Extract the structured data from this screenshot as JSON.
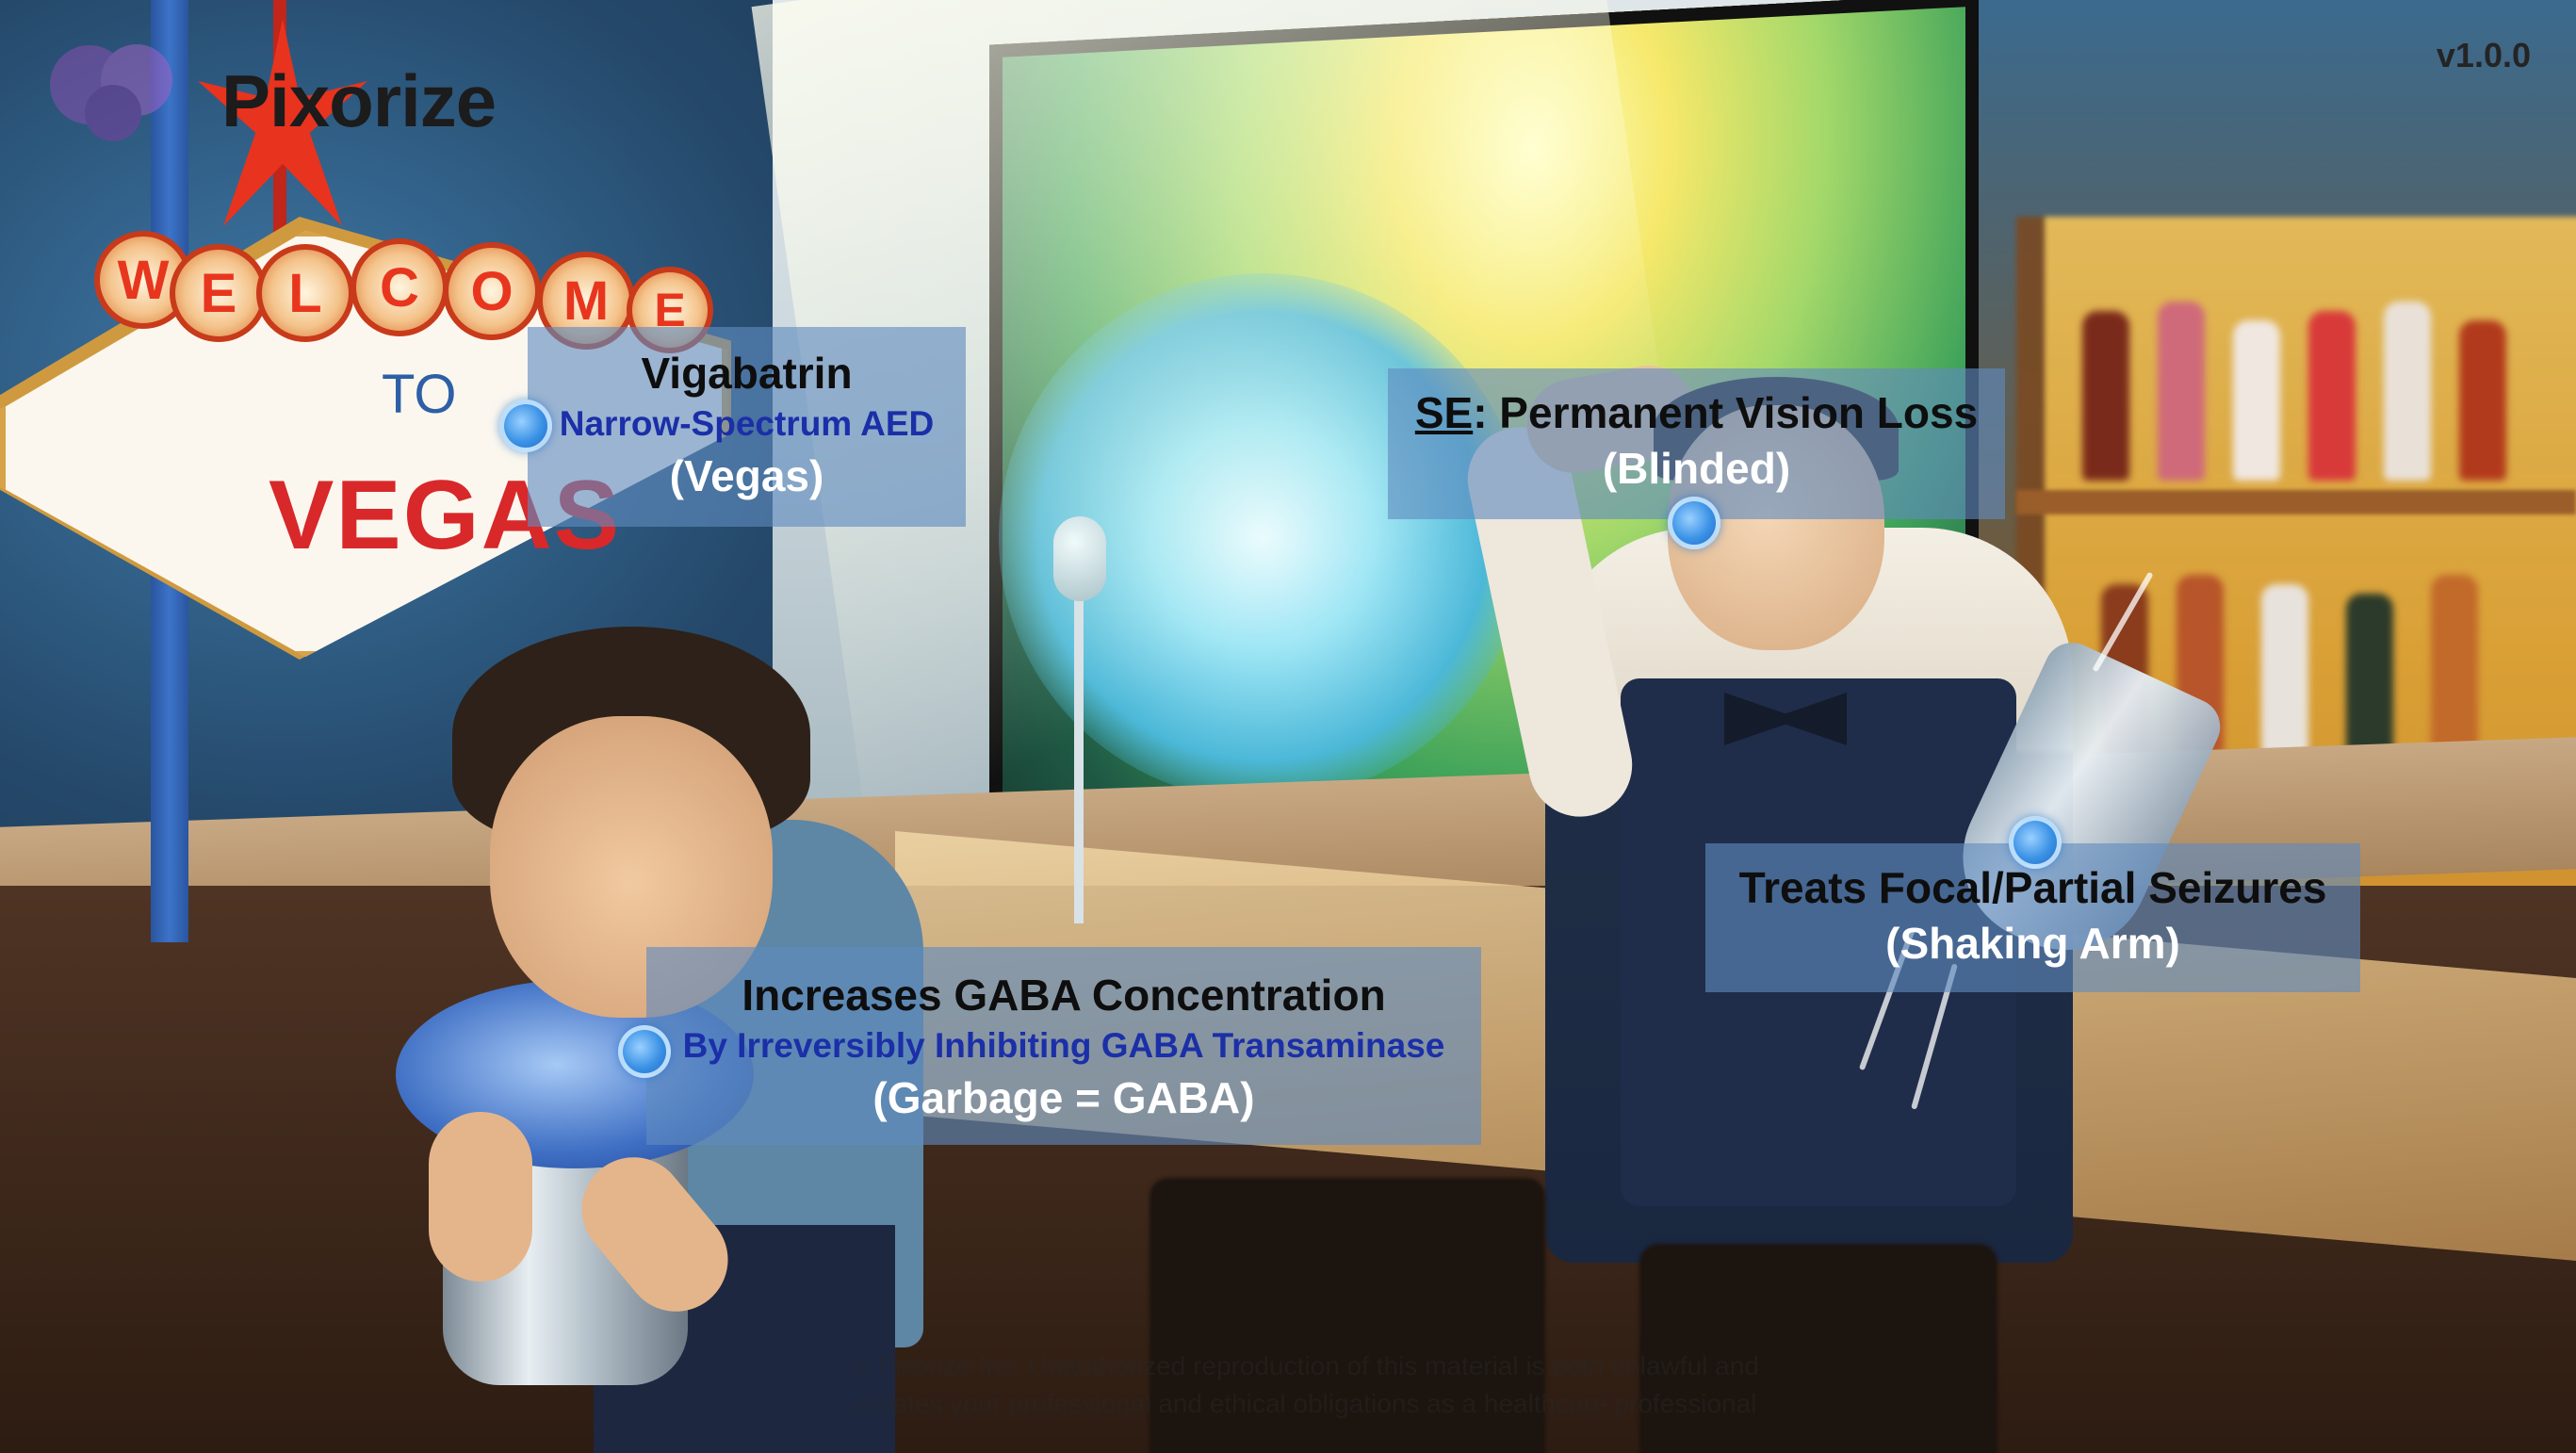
{
  "app": {
    "brand": "Pixorize",
    "version": "v1.0.0"
  },
  "scene": {
    "sign_welcome_letters": [
      "W",
      "E",
      "L",
      "C",
      "O",
      "M",
      "E"
    ],
    "sign_to": "TO",
    "sign_vegas": "VEGAS"
  },
  "labels": [
    {
      "title": "Vigabatrin",
      "subtitle": "Narrow-Spectrum AED",
      "mnemonic": "(Vegas)"
    },
    {
      "title_prefix": "SE",
      "title_rest": ": Permanent Vision Loss",
      "mnemonic": "(Blinded)"
    },
    {
      "title": "Treats Focal/Partial Seizures",
      "mnemonic": "(Shaking Arm)"
    },
    {
      "title": "Increases GABA Concentration",
      "subtitle": "By Irreversibly Inhibiting GABA Transaminase",
      "mnemonic": "(Garbage = GABA)"
    }
  ],
  "copyright": {
    "line1": "© Pixorize Inc. Unauthorized reproduction of this material is both unlawful and",
    "line2": "violates your professional and ethical obligations as a healthcare professional"
  },
  "colors": {
    "label_bg": "#5f8abe",
    "hotspot": "#3c93e6",
    "subtitle_text": "#1b2fa8"
  },
  "icons": {
    "hotspot": "hotspot-dot-icon",
    "logo_mark": "pixorize-brain-icon"
  }
}
